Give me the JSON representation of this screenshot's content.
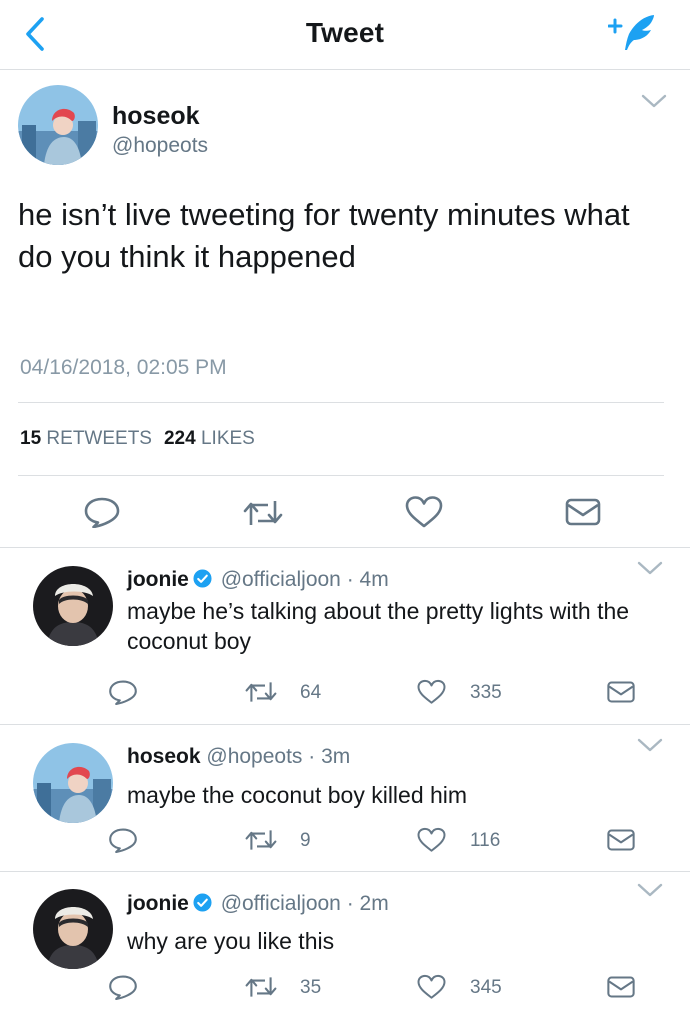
{
  "header": {
    "title": "Tweet",
    "back_icon": "chevron-left-icon",
    "compose_icon": "compose-tweet-icon",
    "accent_color": "#1da1f2"
  },
  "tweet": {
    "name": "hoseok",
    "handle": "@hopeots",
    "text": "he isn’t live tweeting for twenty minutes what do you think it happened",
    "timestamp": "04/16/2018, 02:05 PM",
    "retweets_count": "15",
    "retweets_label": "RETWEETS",
    "likes_count": "224",
    "likes_label": "LIKES",
    "actions": [
      "reply-icon",
      "retweet-icon",
      "like-icon",
      "share-icon"
    ]
  },
  "replies": [
    {
      "name": "joonie",
      "verified": true,
      "handle": "@officialjoon",
      "time": "· 4m",
      "text": "maybe he’s talking about the pretty lights with the coconut boy",
      "retweets": "64",
      "likes": "335"
    },
    {
      "name": "hoseok",
      "verified": false,
      "handle": "@hopeots",
      "time": "· 3m",
      "text": "maybe the coconut boy killed him",
      "retweets": "9",
      "likes": "116"
    },
    {
      "name": "joonie",
      "verified": true,
      "handle": "@officialjoon",
      "time": "· 2m",
      "text": "why are you like this",
      "retweets": "35",
      "likes": "345"
    }
  ]
}
